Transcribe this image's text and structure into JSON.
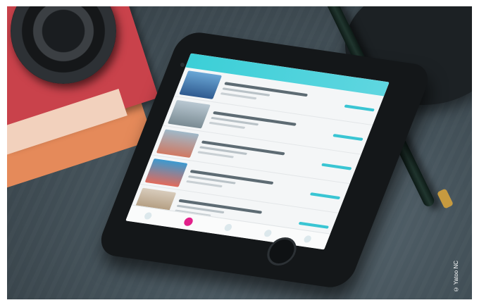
{
  "photo": {
    "credit": "© Yatoo NC"
  }
}
